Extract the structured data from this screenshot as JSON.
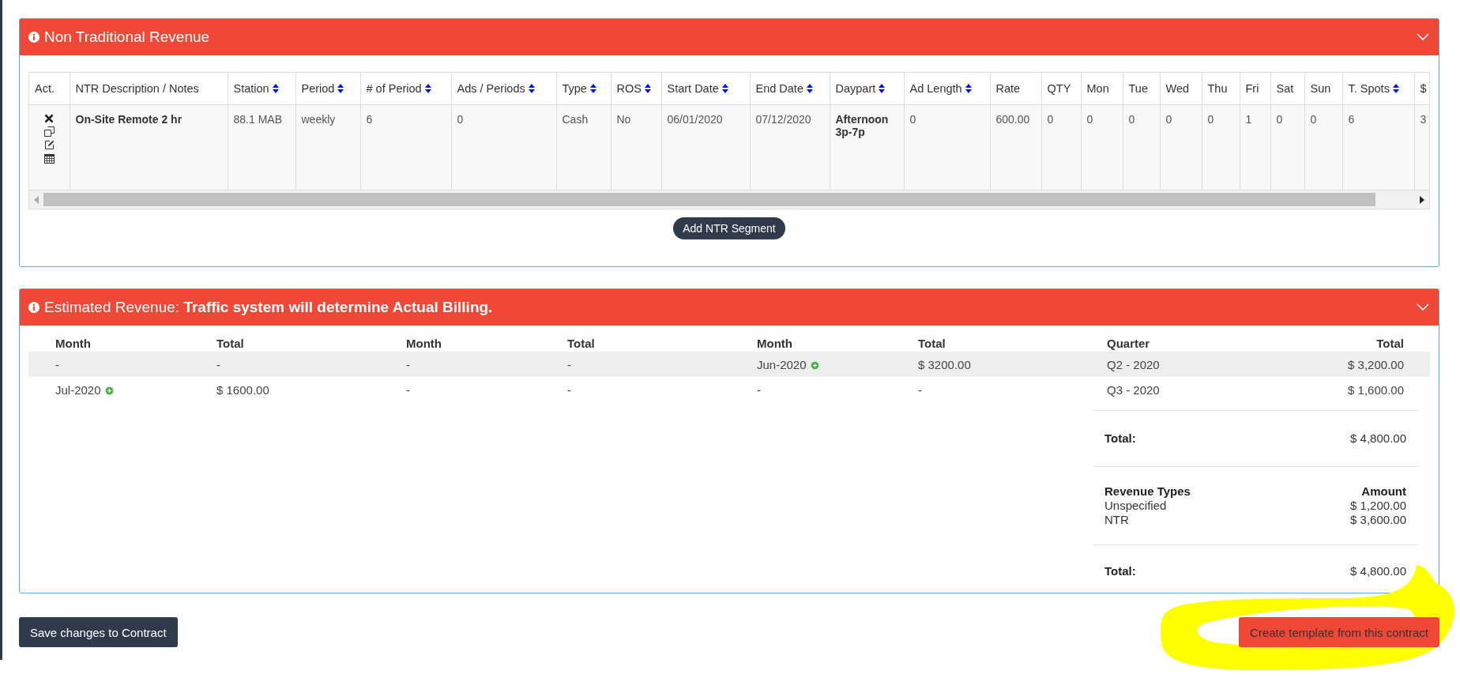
{
  "ntr_panel": {
    "title": "Non Traditional Revenue",
    "expanded": true,
    "columns": [
      {
        "label": "Act.",
        "sortable": false
      },
      {
        "label": "NTR Description / Notes",
        "sortable": false
      },
      {
        "label": "Station",
        "sortable": true
      },
      {
        "label": "Period",
        "sortable": true
      },
      {
        "label": "# of Period",
        "sortable": true
      },
      {
        "label": "Ads / Periods",
        "sortable": true
      },
      {
        "label": "Type",
        "sortable": true
      },
      {
        "label": "ROS",
        "sortable": true
      },
      {
        "label": "Start Date",
        "sortable": true
      },
      {
        "label": "End Date",
        "sortable": true
      },
      {
        "label": "Daypart",
        "sortable": true
      },
      {
        "label": "Ad Length",
        "sortable": true
      },
      {
        "label": "Rate",
        "sortable": false
      },
      {
        "label": "QTY",
        "sortable": false
      },
      {
        "label": "Mon",
        "sortable": false
      },
      {
        "label": "Tue",
        "sortable": false
      },
      {
        "label": "Wed",
        "sortable": false
      },
      {
        "label": "Thu",
        "sortable": false
      },
      {
        "label": "Fri",
        "sortable": false
      },
      {
        "label": "Sat",
        "sortable": false
      },
      {
        "label": "Sun",
        "sortable": false
      },
      {
        "label": "T. Spots",
        "sortable": true
      },
      {
        "label": "$",
        "sortable": false
      }
    ],
    "rows": [
      {
        "cells": [
          {
            "kind": "actions"
          },
          {
            "text": "On-Site Remote 2 hr",
            "bold": true
          },
          {
            "text": "88.1 MAB",
            "bold": false
          },
          {
            "text": "weekly",
            "bold": false
          },
          {
            "text": "6",
            "bold": false
          },
          {
            "text": "0",
            "bold": false
          },
          {
            "text": "Cash",
            "bold": false
          },
          {
            "text": "No",
            "bold": false
          },
          {
            "text": "06/01/2020",
            "bold": false
          },
          {
            "text": "07/12/2020",
            "bold": false
          },
          {
            "text": "Afternoon 3p-7p",
            "bold": true
          },
          {
            "text": "0",
            "bold": false
          },
          {
            "text": "600.00",
            "bold": false
          },
          {
            "text": "0",
            "bold": false
          },
          {
            "text": "0",
            "bold": false
          },
          {
            "text": "0",
            "bold": false
          },
          {
            "text": "0",
            "bold": false
          },
          {
            "text": "0",
            "bold": false
          },
          {
            "text": "1",
            "bold": false
          },
          {
            "text": "0",
            "bold": false
          },
          {
            "text": "0",
            "bold": false
          },
          {
            "text": "6",
            "bold": false
          },
          {
            "text": "3",
            "bold": false
          }
        ]
      }
    ],
    "add_button": "Add NTR Segment"
  },
  "estimate_panel": {
    "title": "Estimated Revenue:",
    "title_note": "Traffic system will determine Actual Billing.",
    "expanded": true,
    "columns": [
      "Month",
      "Total",
      "Month",
      "Total",
      "Month",
      "Total",
      "Quarter",
      "Total"
    ],
    "rows": [
      {
        "cells": [
          {
            "text": "-",
            "add_icon": false
          },
          {
            "text": "-",
            "add_icon": false
          },
          {
            "text": "-",
            "add_icon": false
          },
          {
            "text": "-",
            "add_icon": false
          },
          {
            "text": "Jun-2020",
            "add_icon": true
          },
          {
            "text": "$ 3200.00",
            "add_icon": false
          },
          {
            "text": "Q2 - 2020",
            "add_icon": false
          },
          {
            "text": "$ 3,200.00",
            "add_icon": false
          }
        ]
      },
      {
        "cells": [
          {
            "text": "Jul-2020",
            "add_icon": true
          },
          {
            "text": "$ 1600.00",
            "add_icon": false
          },
          {
            "text": "-",
            "add_icon": false
          },
          {
            "text": "-",
            "add_icon": false
          },
          {
            "text": "-",
            "add_icon": false
          },
          {
            "text": "-",
            "add_icon": false
          },
          {
            "text": "Q3 - 2020",
            "add_icon": false
          },
          {
            "text": "$ 1,600.00",
            "add_icon": false
          }
        ]
      }
    ],
    "total": {
      "label": "Total:",
      "value": "$ 4,800.00"
    },
    "revenue_types": {
      "heading": "Revenue Types",
      "amount_heading": "Amount",
      "items": [
        {
          "name": "Unspecified",
          "amount": "$ 1,200.00"
        },
        {
          "name": "NTR",
          "amount": "$ 3,600.00"
        }
      ]
    },
    "grand_total": {
      "label": "Total:",
      "value": "$ 4,800.00"
    }
  },
  "buttons": [
    {
      "label": "Save changes to Contract",
      "kind": "dark",
      "highlighted": false
    },
    {
      "label": "Create template from this contract",
      "kind": "red",
      "highlighted": true
    }
  ]
}
